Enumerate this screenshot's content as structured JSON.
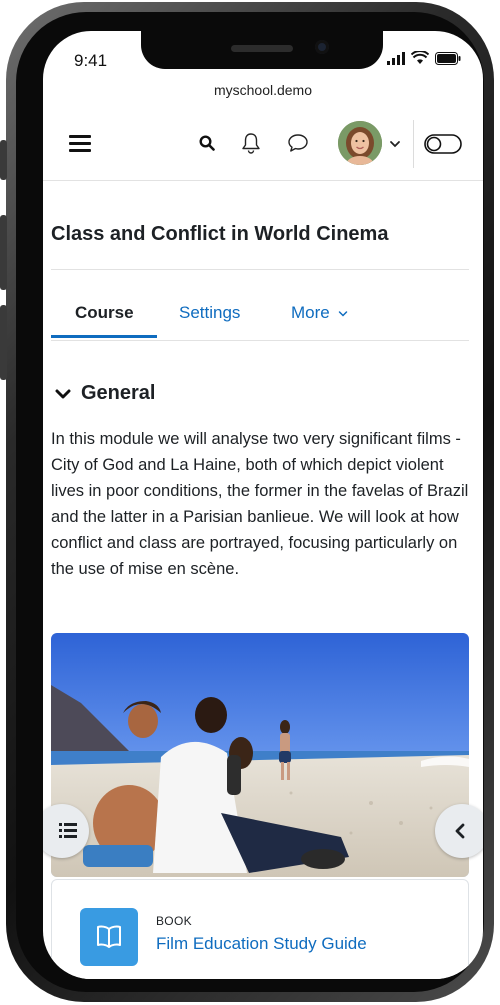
{
  "status_bar": {
    "time": "9:41"
  },
  "browser": {
    "url": "myschool.demo"
  },
  "navbar": {
    "menu_icon": "hamburger-icon",
    "search_icon": "search-icon",
    "notifications_icon": "bell-icon",
    "messages_icon": "chat-bubble-icon",
    "user_menu_icon": "chevron-down-icon",
    "edit_mode_toggle_icon": "toggle-off-icon"
  },
  "course": {
    "title": "Class and Conflict in World Cinema"
  },
  "tabs": [
    {
      "label": "Course",
      "active": true
    },
    {
      "label": "Settings",
      "active": false
    },
    {
      "label": "More",
      "active": false
    }
  ],
  "section": {
    "title": "General",
    "collapse_icon": "chevron-down-icon",
    "description": "In this module we will analyse two very significant films - City of God and La Haine, both of which depict violent lives in poor conditions, the former in the favelas of Brazil and the latter in a Parisian banlieue. We will look at how conflict and class are portrayed, focusing particularly on the use of mise en scène."
  },
  "drawers": {
    "left_icon": "course-index-icon",
    "right_icon": "chevron-left-icon"
  },
  "activity": {
    "type": "BOOK",
    "name": "Film Education Study Guide",
    "icon": "book-icon"
  },
  "colors": {
    "accent": "#0f6cbf",
    "text": "#1d2125",
    "book_icon_bg": "#399be2"
  }
}
